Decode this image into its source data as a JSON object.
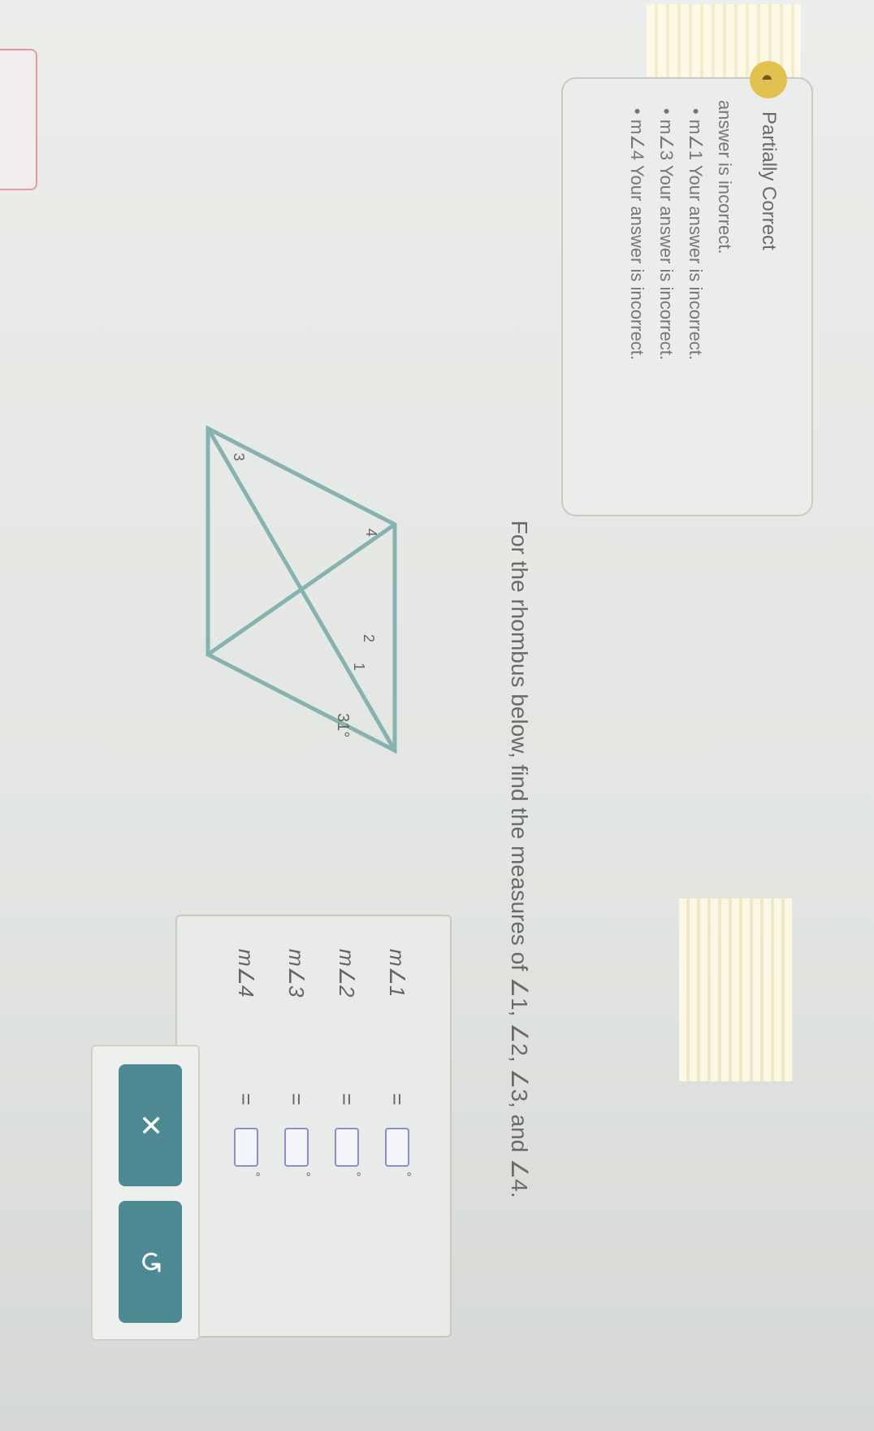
{
  "feedback": {
    "status": "Partially Correct",
    "summary": "answer is incorrect.",
    "items": [
      {
        "angle": "m∠1",
        "message": "Your answer is incorrect."
      },
      {
        "angle": "m∠3",
        "message": "Your answer is incorrect."
      },
      {
        "angle": "m∠4",
        "message": "Your answer is incorrect."
      }
    ]
  },
  "question": {
    "text": "For the rhombus below, find the measures of ∠1, ∠2, ∠3, and ∠4."
  },
  "diagram": {
    "labels": {
      "angle1": "1",
      "angle2": "2",
      "angle3": "3",
      "angle4": "4",
      "given": "31°"
    },
    "stroke_color": "#86b3b0"
  },
  "answers": {
    "rows": [
      {
        "label": "m∠1",
        "equals": "=",
        "value": "",
        "unit": "°"
      },
      {
        "label": "m∠2",
        "equals": "=",
        "value": "",
        "unit": "°"
      },
      {
        "label": "m∠3",
        "equals": "=",
        "value": "",
        "unit": "°"
      },
      {
        "label": "m∠4",
        "equals": "=",
        "value": "",
        "unit": "°"
      }
    ]
  },
  "buttons": {
    "clear_symbol": "✕",
    "undo_symbol": "↺",
    "color": "#4d8993"
  }
}
